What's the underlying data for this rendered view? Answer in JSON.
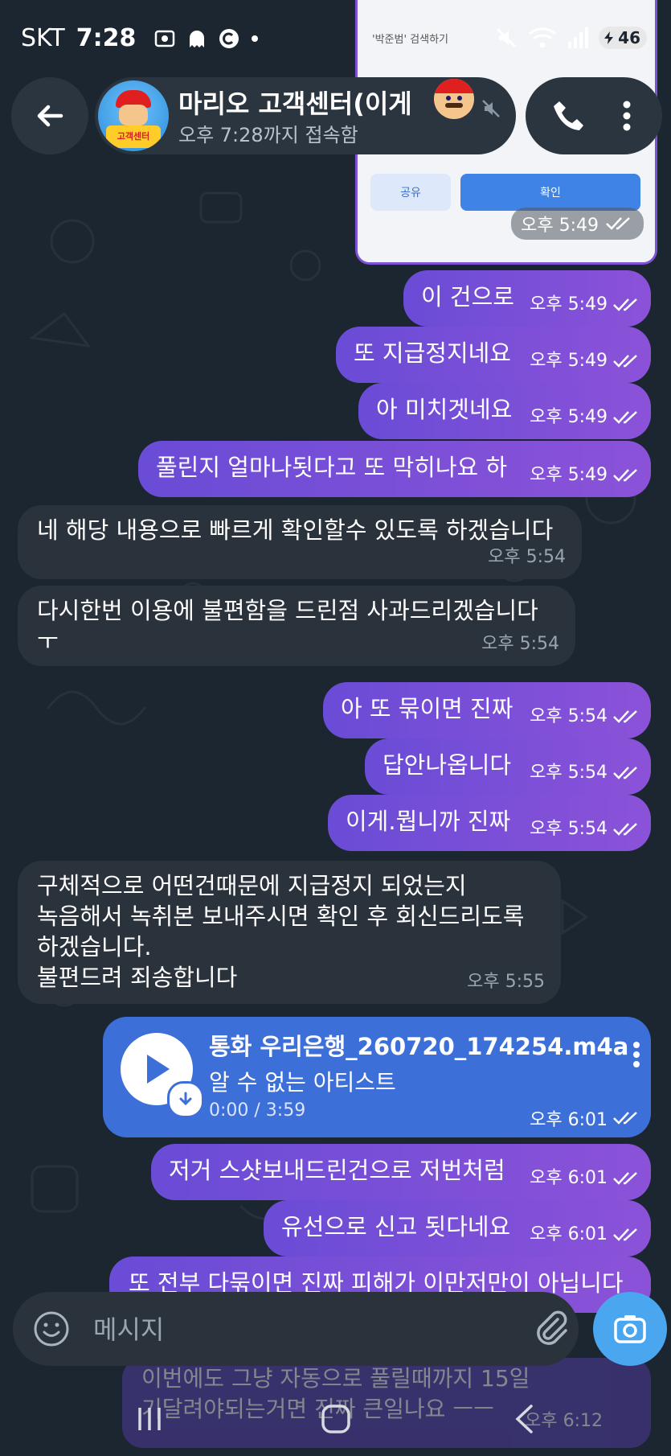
{
  "status_bar": {
    "carrier": "SKT",
    "time": "7:28",
    "battery": "46",
    "wifi_badge": "6"
  },
  "header": {
    "title": "마리오 고객센터(이게",
    "subtitle": "오후 7:28까지 접속함",
    "avatar_text": "고객센터",
    "avatar_logo": "마리오"
  },
  "preview": {
    "caption": "'박준범' 검색하기",
    "share_label": "공유",
    "ok_label": "확인",
    "time": "오후 5:49"
  },
  "messages": [
    {
      "dir": "out",
      "text": "이 건으로",
      "time": "오후 5:49"
    },
    {
      "dir": "out",
      "text": "또 지급정지네요",
      "time": "오후 5:49"
    },
    {
      "dir": "out",
      "text": "아 미치겟네요",
      "time": "오후 5:49"
    },
    {
      "dir": "out",
      "text": "풀린지 얼마나됫다고 또 막히나요 하",
      "time": "오후 5:49"
    },
    {
      "dir": "in",
      "text": "네 해당 내용으로 빠르게 확인할수 있도록 하겠습니다",
      "time": "오후 5:54"
    },
    {
      "dir": "in",
      "text": "다시한번 이용에 불편함을 드린점 사과드리겠습니다",
      "text2": "ㅜ",
      "time": "오후 5:54"
    },
    {
      "dir": "out",
      "text": "아 또 묶이면 진짜",
      "time": "오후 5:54"
    },
    {
      "dir": "out",
      "text": "답안나옵니다",
      "time": "오후 5:54"
    },
    {
      "dir": "out",
      "text": "이게.뭡니까 진짜",
      "time": "오후 5:54"
    },
    {
      "dir": "in",
      "text": "구체적으로 어떤건때문에 지급정지 되었는지",
      "text2": "녹음해서 녹취본 보내주시면 확인 후 회신드리도록",
      "text3": "하겠습니다.",
      "text4": "불편드려 죄송합니다",
      "time": "오후 5:55"
    },
    {
      "dir": "out",
      "text": "저거 스샷보내드린건으로 저번처럼",
      "time": "오후 6:01"
    },
    {
      "dir": "out",
      "text": "유선으로 신고 됫다네요",
      "time": "오후 6:01"
    },
    {
      "dir": "out",
      "text": "또 전부 다묶이면 진짜 피해가 이만저만이 아닙니다",
      "time": ""
    }
  ],
  "audio": {
    "title": "통화 우리은행_260720_174254.m4a",
    "artist": "알 수 없는 아티스트",
    "duration": "0:00 / 3:59",
    "time": "오후 6:01"
  },
  "ghost": {
    "line1": "이번에도 그냥 자동으로 풀릴때까지 15일",
    "line2": "기달려야되는거면 진짜 큰일나요 ㅡㅡ",
    "time": "오후 6:12"
  },
  "composer": {
    "placeholder": "메시지"
  },
  "colors": {
    "outgoing": "#7c4fd8",
    "incoming": "#2a323c",
    "audio": "#3d6fd9",
    "camera": "#4aa6ee"
  }
}
